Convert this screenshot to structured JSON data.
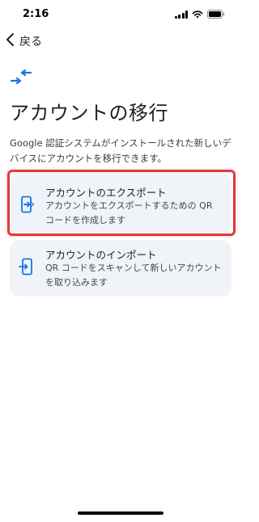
{
  "status_bar": {
    "time": "2:16"
  },
  "nav": {
    "back_label": "戻る"
  },
  "page": {
    "title": "アカウントの移行",
    "description": "Google 認証システムがインストールされた新しいデバイスにアカウントを移行できます。"
  },
  "options": {
    "export": {
      "title": "アカウントのエクスポート",
      "description": "アカウントをエクスポートするための QR コードを作成します",
      "icon": "phone-export-icon"
    },
    "import": {
      "title": "アカウントのインポート",
      "description": "QR コードをスキャンして新しいアカウントを取り込みます",
      "icon": "phone-import-icon"
    }
  },
  "colors": {
    "accent": "#1a73e8",
    "card_background": "#f0f4f9",
    "highlight": "#e5383b"
  },
  "icons": {
    "header": "transfer-arrows-icon",
    "back": "chevron-left-icon"
  }
}
